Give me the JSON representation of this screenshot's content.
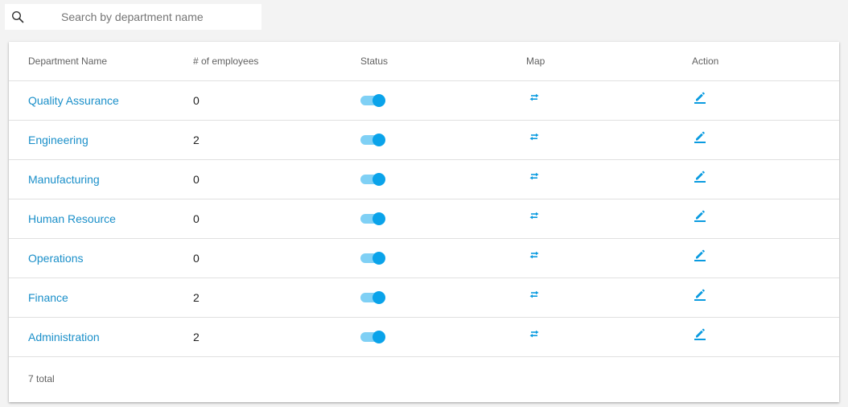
{
  "search": {
    "placeholder": "Search by department name",
    "value": ""
  },
  "table": {
    "headers": {
      "name": "Department Name",
      "employees": "# of employees",
      "status": "Status",
      "map": "Map",
      "action": "Action"
    },
    "rows": [
      {
        "name": "Quality Assurance",
        "employees": "0",
        "status_on": true
      },
      {
        "name": "Engineering",
        "employees": "2",
        "status_on": true
      },
      {
        "name": "Manufacturing",
        "employees": "0",
        "status_on": true
      },
      {
        "name": "Human Resource",
        "employees": "0",
        "status_on": true
      },
      {
        "name": "Operations",
        "employees": "0",
        "status_on": true
      },
      {
        "name": "Finance",
        "employees": "2",
        "status_on": true
      },
      {
        "name": "Administration",
        "employees": "2",
        "status_on": true
      }
    ],
    "total": "7 total"
  },
  "icons": {
    "search": "search-icon",
    "map": "swap-arrows-icon",
    "action": "edit-pencil-icon"
  },
  "colors": {
    "link": "#1a8fc9",
    "toggle_on": "#0aa3ea",
    "toggle_track": "#7fd0f5",
    "icon": "#0a9be0"
  }
}
